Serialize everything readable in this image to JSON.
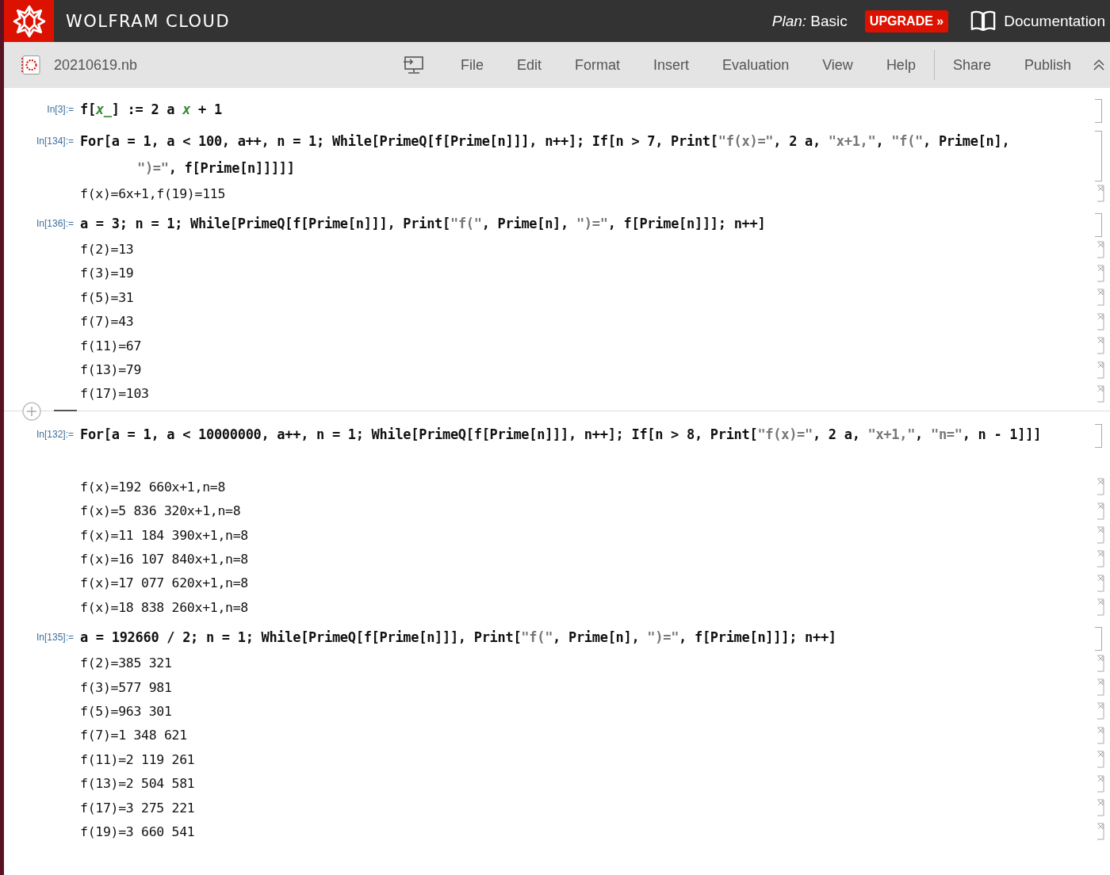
{
  "header": {
    "brand": "WOLFRAM CLOUD",
    "plan": "*Plan:* Basic",
    "upgrade": "UPGRADE »",
    "docs": "Documentation"
  },
  "toolbar": {
    "filename": "20210619.nb",
    "menus": [
      "File",
      "Edit",
      "Format",
      "Insert",
      "Evaluation",
      "View",
      "Help"
    ],
    "actions": [
      "Share",
      "Publish"
    ]
  },
  "cells": [
    {
      "kind": "cell",
      "label": "In[3]:=",
      "lines": [
        [
          {
            "kind": "code",
            "text": "f["
          },
          {
            "kind": "var",
            "text": "x_"
          },
          {
            "kind": "code",
            "text": "] := 2 a "
          },
          {
            "kind": "var",
            "text": "x"
          },
          {
            "kind": "code",
            "text": " + 1"
          }
        ]
      ]
    },
    {
      "kind": "cell",
      "label": "In[134]:=",
      "lines": [
        [
          {
            "kind": "code",
            "text": "For[a = 1, a < 100, a++, n = 1; While[PrimeQ[f[Prime[n]]], n++]; If[n > 7, Print["
          },
          {
            "kind": "string",
            "text": "\"f(x)=\""
          },
          {
            "kind": "code",
            "text": ", 2 a, "
          },
          {
            "kind": "string",
            "text": "\"x+1,\""
          },
          {
            "kind": "code",
            "text": ", "
          },
          {
            "kind": "string",
            "text": "\"f(\""
          },
          {
            "kind": "code",
            "text": ", Prime[n],"
          }
        ],
        [
          {
            "kind": "string",
            "text": "\")=\""
          },
          {
            "kind": "code",
            "text": ", f[Prime[n]]]]]"
          }
        ]
      ],
      "outputs": [
        "f(x)=6x+1,f(19)=115"
      ]
    },
    {
      "kind": "cell",
      "label": "In[136]:=",
      "lines": [
        [
          {
            "kind": "code",
            "text": "a = 3; n = 1; While[PrimeQ[f[Prime[n]]], Print["
          },
          {
            "kind": "string",
            "text": "\"f(\""
          },
          {
            "kind": "code",
            "text": ", Prime[n], "
          },
          {
            "kind": "string",
            "text": "\")=\""
          },
          {
            "kind": "code",
            "text": ", f[Prime[n]]]; n++]"
          }
        ]
      ],
      "outputs": [
        "f(2)=13",
        "f(3)=19",
        "f(5)=31",
        "f(7)=43",
        "f(11)=67",
        "f(13)=79",
        "f(17)=103"
      ]
    },
    {
      "kind": "insertion"
    },
    {
      "kind": "cell",
      "label": "In[132]:=",
      "lines": [
        [
          {
            "kind": "code",
            "text": "For[a = 1, a < 10000000, a++, n = 1; While[PrimeQ[f[Prime[n]]], n++]; If[n > 8, Print["
          },
          {
            "kind": "string",
            "text": "\"f(x)=\""
          },
          {
            "kind": "code",
            "text": ", 2 a, "
          },
          {
            "kind": "string",
            "text": "\"x+1,\""
          },
          {
            "kind": "code",
            "text": ", "
          },
          {
            "kind": "string",
            "text": "\"n=\""
          },
          {
            "kind": "code",
            "text": ", n - 1]]]"
          }
        ]
      ],
      "outputs": [
        "f(x)=192 660x+1,n=8",
        "f(x)=5 836 320x+1,n=8",
        "f(x)=11 184 390x+1,n=8",
        "f(x)=16 107 840x+1,n=8",
        "f(x)=17 077 620x+1,n=8",
        "f(x)=18 838 260x+1,n=8"
      ]
    },
    {
      "kind": "cell",
      "label": "In[135]:=",
      "lines": [
        [
          {
            "kind": "code",
            "text": "a = 192660 / 2; n = 1; While[PrimeQ[f[Prime[n]]], Print["
          },
          {
            "kind": "string",
            "text": "\"f(\""
          },
          {
            "kind": "code",
            "text": ", Prime[n], "
          },
          {
            "kind": "string",
            "text": "\")=\""
          },
          {
            "kind": "code",
            "text": ", f[Prime[n]]]; n++]"
          }
        ]
      ],
      "outputs": [
        "f(2)=385 321",
        "f(3)=577 981",
        "f(5)=963 301",
        "f(7)=1 348 621",
        "f(11)=2 119 261",
        "f(13)=2 504 581",
        "f(17)=3 275 221",
        "f(19)=3 660 541"
      ]
    }
  ]
}
